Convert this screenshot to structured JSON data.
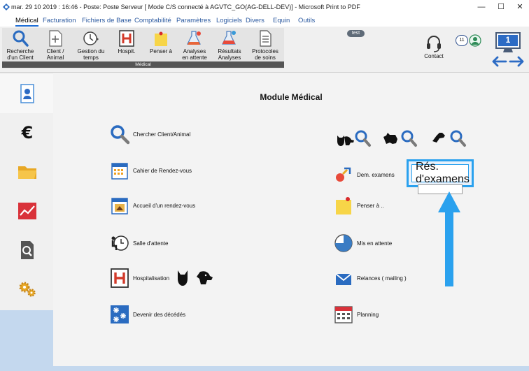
{
  "titlebar": {
    "text": "mar. 29 10 2019 : 16:46 - Poste: Poste Serveur  [ Mode C/S connecté à AGVTC_GO(AG-DELL-DEV)] - Microsoft Print to PDF",
    "minimize": "—",
    "maximize": "☐",
    "close": "✕"
  },
  "menu": [
    "Médical",
    "Facturation",
    "Fichiers de Base",
    "Comptabilité",
    "Paramètres",
    "Logiciels",
    "Divers",
    "Equin",
    "Outils"
  ],
  "ribbon": {
    "buttons": [
      {
        "line1": "Recherche",
        "line2": "d'un Client",
        "icon": "search-icon"
      },
      {
        "line1": "Client /",
        "line2": "Animal",
        "icon": "document-plus-icon"
      },
      {
        "line1": "Gestion du",
        "line2": "temps",
        "icon": "clock-icon"
      },
      {
        "line1": "",
        "line2": "Hospit.",
        "icon": "hospital-icon"
      },
      {
        "line1": "",
        "line2": "Penser à",
        "icon": "sticky-note-icon"
      },
      {
        "line1": "Analyses",
        "line2": "en attente",
        "icon": "flask-icon"
      },
      {
        "line1": "Résultats",
        "line2": "Analyses",
        "icon": "flask-results-icon"
      },
      {
        "line1": "Protocoles",
        "line2": "de soins",
        "icon": "protocol-document-icon"
      }
    ],
    "group_caption": "Médical"
  },
  "status": {
    "test_badge": "test",
    "contact_label": "Contact",
    "count_badge": "11",
    "screen_number": "1"
  },
  "page": {
    "title": "Module Médical"
  },
  "left_items": [
    {
      "label": "Chercher Client/Animal",
      "icon": "search-icon"
    },
    {
      "label": "Cahier de Rendez-vous",
      "icon": "calendar-icon"
    },
    {
      "label": "Accueil d'un rendez-vous",
      "icon": "appointment-welcome-icon"
    },
    {
      "label": "Salle d'attente",
      "icon": "waiting-room-icon"
    },
    {
      "label": "Hospitalisation",
      "icon": "hospital-icon"
    },
    {
      "label": "Devenir des décédés",
      "icon": "snowflake-icon"
    }
  ],
  "right_items": [
    {
      "label": "Dem. examens",
      "icon": "exam-request-icon"
    },
    {
      "label": "Rés. d'examens",
      "icon": "exam-results-icon"
    },
    {
      "label": "Penser à ..",
      "icon": "sticky-note-icon"
    },
    {
      "label": "Mis en attente",
      "icon": "pie-clock-icon"
    },
    {
      "label": "Relances ( mailing )",
      "icon": "envelope-icon"
    },
    {
      "label": "Planning",
      "icon": "planning-calendar-icon"
    }
  ],
  "colors": {
    "accent": "#2aa1ee",
    "menu_text": "#2c5aa0",
    "sidebar_active": "#4a8fd8"
  }
}
